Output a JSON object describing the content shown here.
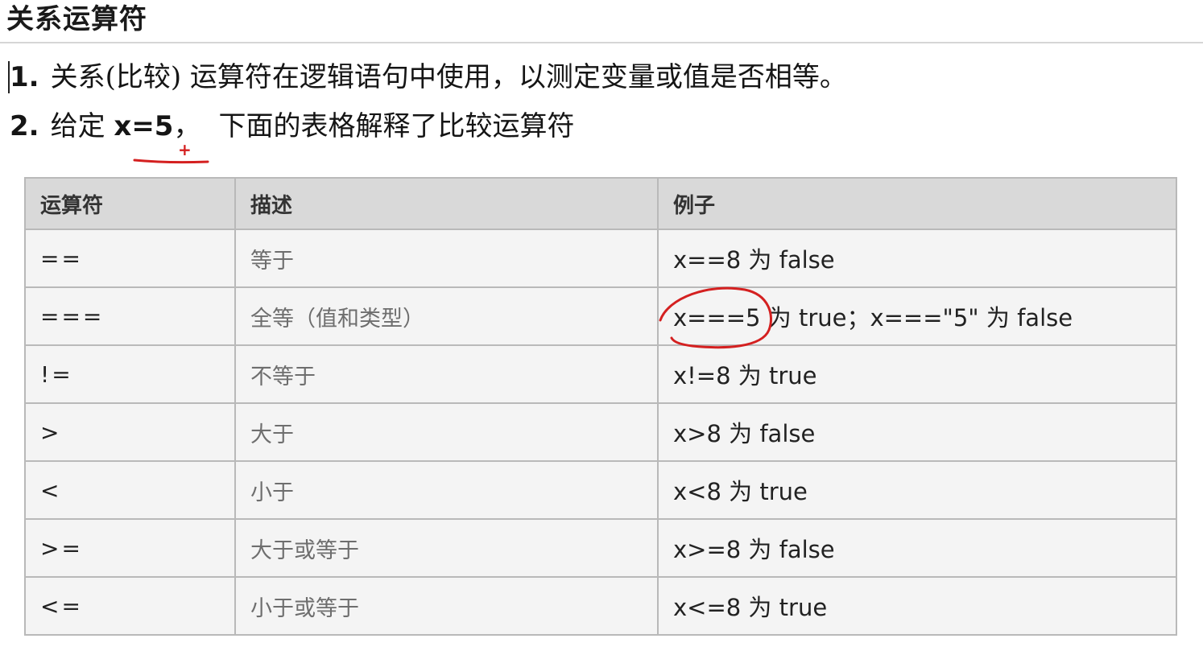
{
  "heading": "关系运算符",
  "intro": {
    "line1": {
      "number": "1.",
      "text": "关系(比较) 运算符在逻辑语句中使用，以测定变量或值是否相等。"
    },
    "line2": {
      "number": "2.",
      "prefix": "给定",
      "expr": "x=5",
      "sep": "，",
      "text": "下面的表格解释了比较运算符"
    }
  },
  "table": {
    "headers": [
      "运算符",
      "描述",
      "例子"
    ],
    "rows": [
      {
        "op": "==",
        "desc": "等于",
        "example": "x==8 为 false"
      },
      {
        "op": "===",
        "desc": "全等（值和类型）",
        "example": "x===5 为 true；x===\"5\" 为 false"
      },
      {
        "op": "!=",
        "desc": "不等于",
        "example": "x!=8 为 true"
      },
      {
        "op": ">",
        "desc": "大于",
        "example": "x>8 为 false"
      },
      {
        "op": "<",
        "desc": "小于",
        "example": "x<8 为 true"
      },
      {
        "op": ">=",
        "desc": "大于或等于",
        "example": "x>=8 为 false"
      },
      {
        "op": "<=",
        "desc": "小于或等于",
        "example": "x<=8 为 true"
      }
    ]
  },
  "annotations": {
    "color": "#d42020",
    "mark": "+"
  }
}
